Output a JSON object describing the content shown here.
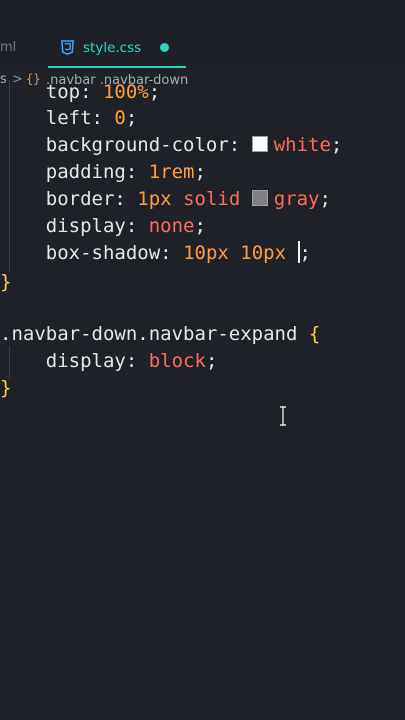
{
  "tabs": {
    "previous_fragment": "ml",
    "active_label": "style.css"
  },
  "breadcrumb": {
    "start_fragment": "s",
    "separator": ">",
    "icon_glyph": "{}",
    "path": ".navbar .navbar-down"
  },
  "code": {
    "line_partial": {
      "prop": "top:",
      "value": "100%",
      "end": ";"
    },
    "line_left": {
      "prop": "left:",
      "value": "0",
      "end": ";"
    },
    "line_bg": {
      "prop": "background-color:",
      "swatch_color": "#ffffff",
      "value": "white",
      "end": ";"
    },
    "line_padding": {
      "prop": "padding:",
      "value": "1rem",
      "end": ";"
    },
    "line_border": {
      "prop": "border:",
      "v1": "1px",
      "v2": "solid",
      "swatch_color": "#808080",
      "v3": "gray",
      "end": ";"
    },
    "line_display": {
      "prop": "display:",
      "value": "none",
      "end": ";"
    },
    "line_shadow": {
      "prop": "box-shadow:",
      "v1": "10px",
      "v2": "10px",
      "end": ";"
    },
    "close1": "}",
    "rule2_selector": ".navbar-down.navbar-expand",
    "rule2_open": "{",
    "rule2_prop": "display:",
    "rule2_value": "block",
    "rule2_end": ";",
    "close2": "}"
  },
  "colors": {
    "accent": "#2dd4bf",
    "background": "#1f2129",
    "number": "#ff9e3d",
    "keyword": "#ff6b5b",
    "brace": "#ffd33d"
  },
  "icons": {
    "css_file": "css3-icon",
    "text_cursor": "text-cursor-icon"
  }
}
